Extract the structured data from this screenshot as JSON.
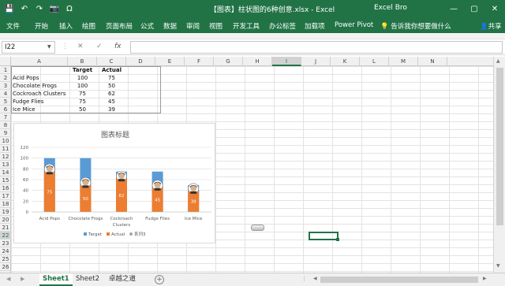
{
  "window": {
    "title": "【图表】柱状图的6种创意.xlsx  -  Excel",
    "user": "Excel Bro",
    "qat": {
      "save": "💾",
      "undo": "↶",
      "redo": "↷",
      "camera": "📷",
      "omega": "Ω"
    },
    "controls": {
      "min": "—",
      "restore": "▢",
      "close": "✕"
    }
  },
  "ribbon": {
    "tabs": [
      "文件",
      "开始",
      "插入",
      "绘图",
      "页面布局",
      "公式",
      "数据",
      "审阅",
      "视图",
      "开发工具",
      "办公标签",
      "加载项",
      "Power Pivot"
    ],
    "tell_me": "告诉我你想要做什么",
    "share": "共享"
  },
  "formula_bar": {
    "name_box": "I22",
    "cancel": "✕",
    "enter": "✓",
    "fx": "fx",
    "value": ""
  },
  "columns": [
    "A",
    "B",
    "C",
    "D",
    "E",
    "F",
    "G",
    "H",
    "I",
    "J",
    "K",
    "L",
    "M",
    "N"
  ],
  "selected_column": "I",
  "rows": [
    "1",
    "2",
    "3",
    "4",
    "5",
    "6",
    "7",
    "8",
    "9",
    "10",
    "11",
    "12",
    "13",
    "14",
    "15",
    "16",
    "17",
    "18",
    "19",
    "20",
    "21",
    "22",
    "23",
    "24",
    "25",
    "26"
  ],
  "selected_row": "22",
  "table": {
    "headers": [
      "",
      "Target",
      "Actual"
    ],
    "rows": [
      [
        "Acid Pops",
        "100",
        "75"
      ],
      [
        "Chocolate Frogs",
        "100",
        "50"
      ],
      [
        "Cockroach Clusters",
        "75",
        "62"
      ],
      [
        "Fudge Flies",
        "75",
        "45"
      ],
      [
        "Ice Mice",
        "50",
        "39"
      ]
    ]
  },
  "chart_data": {
    "type": "bar",
    "title": "图表标题",
    "categories": [
      "Acid Pops",
      "Chocolate Frogs",
      "Cockroach Clusters",
      "Fudge Flies",
      "Ice Mice"
    ],
    "category_lines": [
      [
        "Acid Pops"
      ],
      [
        "Chocolate Frogs"
      ],
      [
        "Cockroach",
        "Clusters"
      ],
      [
        "Fudge Flies"
      ],
      [
        "Ice Mice"
      ]
    ],
    "series": [
      {
        "name": "Target",
        "values": [
          100,
          100,
          75,
          75,
          50
        ],
        "color": "#5b9bd5"
      },
      {
        "name": "Actual",
        "values": [
          75,
          50,
          62,
          45,
          39
        ],
        "color": "#ed7d31"
      },
      {
        "name": "系列3",
        "values": [
          75,
          50,
          62,
          45,
          39
        ],
        "color": "#a5a5a5",
        "marker": "face-picture"
      }
    ],
    "data_labels": [
      "75",
      "50",
      "62",
      "45",
      "39"
    ],
    "yticks": [
      "0",
      "20",
      "40",
      "60",
      "80",
      "100",
      "120"
    ],
    "ylim": [
      0,
      120
    ],
    "grid": true,
    "legend_position": "bottom"
  },
  "sheet_tabs": [
    "Sheet1",
    "Sheet2",
    "卓越之道"
  ],
  "active_sheet": "Sheet1",
  "sheet_nav": {
    "prev": "◀",
    "next": "▶",
    "add": "+",
    "more": "⋮"
  }
}
